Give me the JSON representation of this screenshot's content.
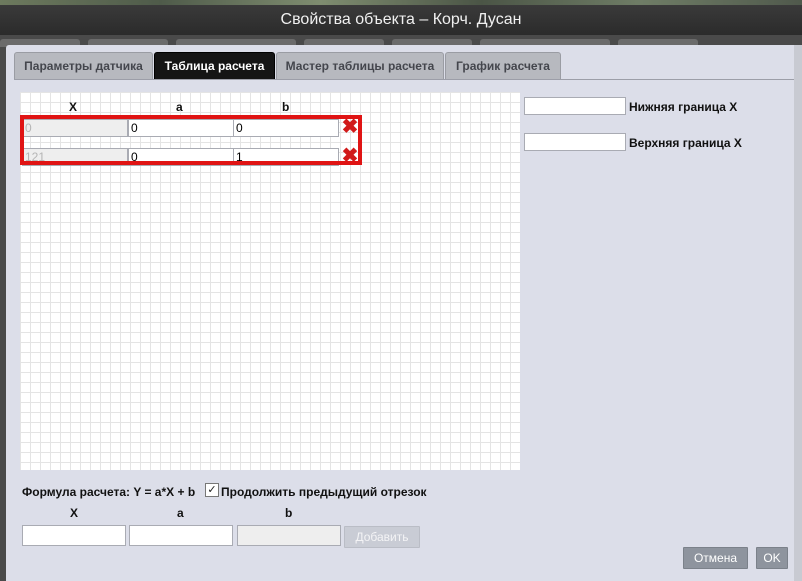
{
  "window": {
    "title": "Свойства объекта – Корч. Дусан"
  },
  "tabs": [
    {
      "label": "Параметры датчика"
    },
    {
      "label": "Таблица расчета"
    },
    {
      "label": "Мастер таблицы расчета"
    },
    {
      "label": "График расчета"
    }
  ],
  "active_tab": "Таблица расчета",
  "table": {
    "headers": {
      "x": "X",
      "a": "a",
      "b": "b"
    },
    "rows": [
      {
        "x": "0",
        "a": "0",
        "b": "0"
      },
      {
        "x": "121",
        "a": "0",
        "b": "1"
      }
    ]
  },
  "bounds": {
    "lower_label": "Нижняя граница X",
    "upper_label": "Верхняя граница X",
    "lower_value": "",
    "upper_value": ""
  },
  "formula": {
    "label": "Формула расчета: Y = a*X + b",
    "continue_label": "Продолжить предыдущий отрезок",
    "continue_checked": true,
    "check_mark": "✓"
  },
  "add_form": {
    "x_label": "X",
    "a_label": "a",
    "b_label": "b",
    "add_button": "Добавить"
  },
  "buttons": {
    "cancel": "Отмена",
    "ok": "OK"
  },
  "icons": {
    "delete": "✖"
  },
  "colors": {
    "highlight": "#e01414",
    "delete_icon": "#d11a1a",
    "active_tab": "#151515"
  }
}
